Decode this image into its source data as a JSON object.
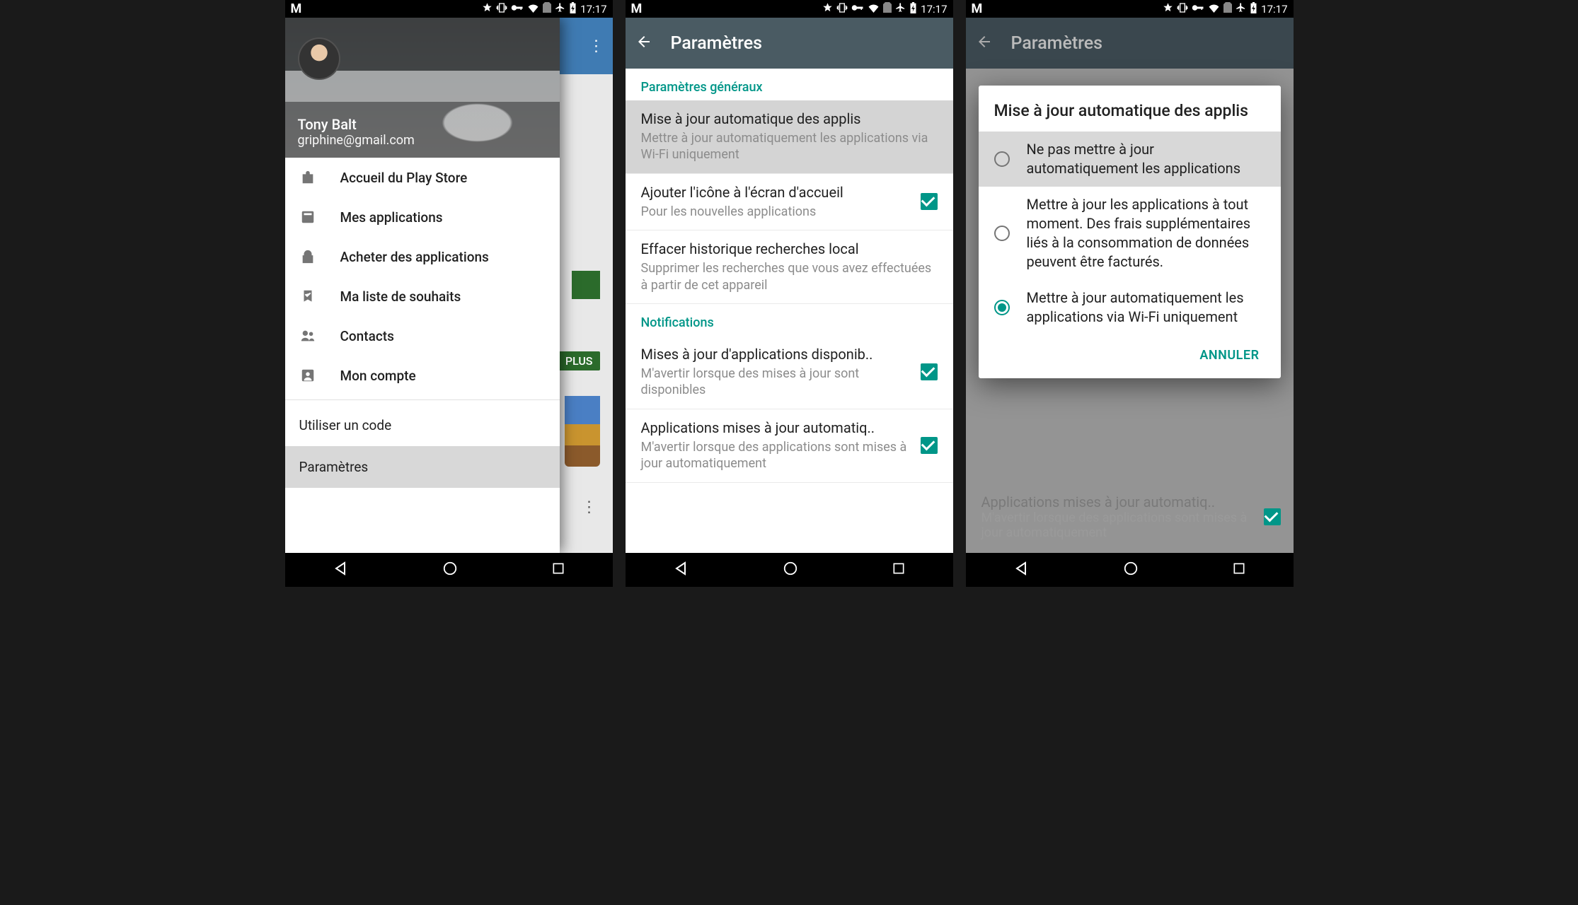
{
  "status": {
    "time": "17:17"
  },
  "screen1": {
    "user": {
      "name": "Tony Balt",
      "email": "griphine@gmail.com"
    },
    "drawer": [
      {
        "icon": "bag",
        "label": "Accueil du Play Store"
      },
      {
        "icon": "apps",
        "label": "Mes applications"
      },
      {
        "icon": "shop",
        "label": "Acheter des applications"
      },
      {
        "icon": "bookmark",
        "label": "Ma liste de souhaits"
      },
      {
        "icon": "people",
        "label": "Contacts"
      },
      {
        "icon": "account",
        "label": "Mon compte"
      }
    ],
    "drawer_plain": [
      {
        "label": "Utiliser un code"
      },
      {
        "label": "Paramètres"
      }
    ],
    "bg_plus": "PLUS",
    "bg_text": "s"
  },
  "screen2": {
    "title": "Paramètres",
    "sections": [
      {
        "header": "Paramètres généraux",
        "items": [
          {
            "title": "Mise à jour automatique des applis",
            "sub": "Mettre à jour automatiquement les applications via Wi-Fi uniquement",
            "checkbox": false,
            "hl": true
          },
          {
            "title": "Ajouter l'icône à l'écran d'accueil",
            "sub": "Pour les nouvelles applications",
            "checkbox": true
          },
          {
            "title": "Effacer historique recherches local",
            "sub": "Supprimer les recherches que vous avez effectuées à partir de cet appareil",
            "checkbox": false
          }
        ]
      },
      {
        "header": "Notifications",
        "items": [
          {
            "title": "Mises à jour d'applications disponib..",
            "sub": "M'avertir lorsque des mises à jour sont disponibles",
            "checkbox": true
          },
          {
            "title": "Applications mises à jour automatiq..",
            "sub": "M'avertir lorsque des applications sont mises à jour automatiquement",
            "checkbox": true
          }
        ]
      }
    ]
  },
  "screen3": {
    "title": "Paramètres",
    "dialog": {
      "title": "Mise à jour automatique des applis",
      "options": [
        {
          "label": "Ne pas mettre à jour automatiquement les applications",
          "selected": false,
          "hl": true
        },
        {
          "label": "Mettre à jour les applications à tout moment. Des frais supplémentaires liés à la consommation de données peuvent être facturés.",
          "selected": false
        },
        {
          "label": "Mettre à jour automatiquement les applications via Wi-Fi uniquement",
          "selected": true
        }
      ],
      "cancel": "ANNULER"
    },
    "behind": {
      "title": "Applications mises à jour automatiq..",
      "sub": "M'avertir lorsque des applications sont mises à jour automatiquement"
    }
  }
}
